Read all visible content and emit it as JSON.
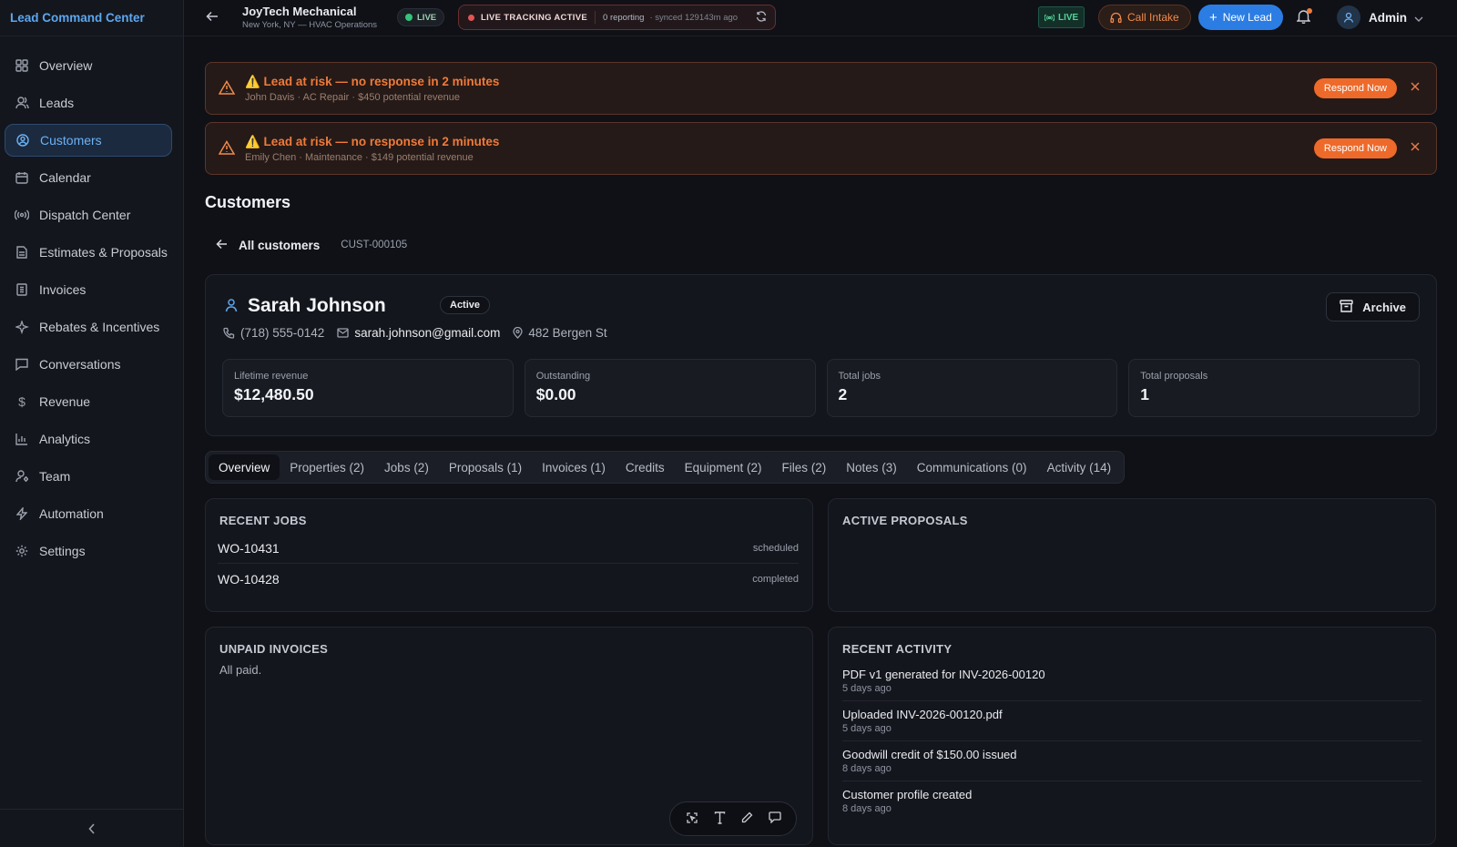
{
  "brand": "Lead Command Center",
  "nav": [
    {
      "label": "Overview",
      "icon": "grid-icon"
    },
    {
      "label": "Leads",
      "icon": "users-icon"
    },
    {
      "label": "Customers",
      "icon": "user-circle-icon",
      "active": true
    },
    {
      "label": "Calendar",
      "icon": "calendar-icon"
    },
    {
      "label": "Dispatch Center",
      "icon": "broadcast-icon"
    },
    {
      "label": "Estimates & Proposals",
      "icon": "document-icon"
    },
    {
      "label": "Invoices",
      "icon": "receipt-icon"
    },
    {
      "label": "Rebates & Incentives",
      "icon": "sparkle-icon"
    },
    {
      "label": "Conversations",
      "icon": "chat-icon"
    },
    {
      "label": "Revenue",
      "icon": "dollar-icon"
    },
    {
      "label": "Analytics",
      "icon": "bar-chart-icon"
    },
    {
      "label": "Team",
      "icon": "team-icon"
    },
    {
      "label": "Automation",
      "icon": "bolt-icon"
    },
    {
      "label": "Settings",
      "icon": "gear-icon"
    }
  ],
  "topbar": {
    "company": "JoyTech Mechanical",
    "company_sub": "New York, NY — HVAC Operations",
    "live": "LIVE",
    "tracking": "LIVE TRACKING ACTIVE",
    "reporting": "0 reporting",
    "synced": "· synced 129143m ago",
    "live2": "LIVE",
    "call_intake": "Call Intake",
    "new_lead": "New Lead",
    "admin": "Admin"
  },
  "alerts": [
    {
      "title": "⚠️ Lead at risk — no response in 2 minutes",
      "detail": "John Davis · AC Repair · $450 potential revenue",
      "action": "Respond Now"
    },
    {
      "title": "⚠️ Lead at risk — no response in 2 minutes",
      "detail": "Emily Chen · Maintenance · $149 potential revenue",
      "action": "Respond Now"
    }
  ],
  "page_title": "Customers",
  "breadcrumb": {
    "back": "All customers",
    "id": "CUST-000105"
  },
  "customer": {
    "name": "Sarah Johnson",
    "status": "Active",
    "archive": "Archive",
    "phone": "(718) 555-0142",
    "email": "sarah.johnson@gmail.com",
    "address": "482 Bergen St",
    "stats": [
      {
        "label": "Lifetime revenue",
        "value": "$12,480.50"
      },
      {
        "label": "Outstanding",
        "value": "$0.00"
      },
      {
        "label": "Total jobs",
        "value": "2"
      },
      {
        "label": "Total proposals",
        "value": "1"
      }
    ]
  },
  "tabs": [
    {
      "label": "Overview",
      "active": true
    },
    {
      "label": "Properties (2)"
    },
    {
      "label": "Jobs (2)"
    },
    {
      "label": "Proposals (1)"
    },
    {
      "label": "Invoices (1)"
    },
    {
      "label": "Credits"
    },
    {
      "label": "Equipment (2)"
    },
    {
      "label": "Files (2)"
    },
    {
      "label": "Notes (3)"
    },
    {
      "label": "Communications (0)"
    },
    {
      "label": "Activity (14)"
    }
  ],
  "recent_jobs": {
    "title": "RECENT JOBS",
    "rows": [
      {
        "id": "WO-10431",
        "status": "scheduled"
      },
      {
        "id": "WO-10428",
        "status": "completed"
      }
    ]
  },
  "active_proposals": {
    "title": "ACTIVE PROPOSALS"
  },
  "unpaid_invoices": {
    "title": "UNPAID INVOICES",
    "note": "All paid."
  },
  "recent_activity": {
    "title": "RECENT ACTIVITY",
    "items": [
      {
        "text": "PDF v1 generated for INV-2026-00120",
        "time": "5 days ago"
      },
      {
        "text": "Uploaded INV-2026-00120.pdf",
        "time": "5 days ago"
      },
      {
        "text": "Goodwill credit of $150.00 issued",
        "time": "8 days ago"
      },
      {
        "text": "Customer profile created",
        "time": "8 days ago"
      }
    ]
  },
  "colors": {
    "accent": "#2b7de3",
    "brand": "#5ba7f0",
    "warning": "#f07a3a",
    "live": "#34c37a"
  }
}
